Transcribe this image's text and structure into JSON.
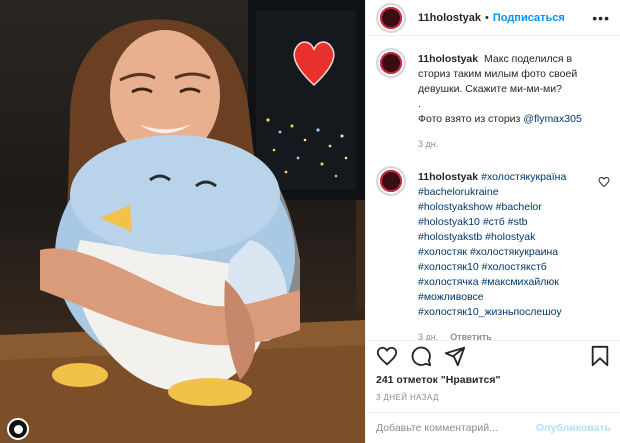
{
  "post": {
    "username": "11holostyak",
    "follow_label": "Подписаться",
    "more_label": "•••"
  },
  "caption": {
    "username": "11holostyak",
    "text": "Макс поделился в сториз таким милым фото своей девушки. Скажите ми-ми-ми?",
    "dot_line": ".",
    "source_prefix": "Фото взято из сториз",
    "source_mention": "@flymax305",
    "time": "3 дн."
  },
  "hashtag_comment": {
    "username": "11holostyak",
    "tags": [
      "#холостякукраїна",
      "#bachelorukraine",
      "#holostyakshow",
      "#bachelor",
      "#holostyak10",
      "#стб",
      "#stb",
      "#holostyakstb",
      "#holostyak",
      "#холостяк",
      "#холостякукраина",
      "#холостяк10",
      "#холостякстб",
      "#холостячка",
      "#максмихайлюк",
      "#можливовсе",
      "#холостяк10_жизньпослешоу"
    ],
    "time": "3 дн.",
    "reply_label": "Ответить"
  },
  "stats": {
    "likes": "241 отметок \"Нравится\"",
    "time_ago": "3 ДНЕЙ НАЗАД"
  },
  "add_comment": {
    "placeholder": "Добавьте комментарий...",
    "post_label": "Опубликовать"
  },
  "icons": {
    "like": "heart-icon",
    "comment": "comment-icon",
    "share": "share-icon",
    "save": "bookmark-icon",
    "sticker": "heart-emoji-icon"
  },
  "colors": {
    "link": "#00376b",
    "follow": "#0095f6",
    "muted": "#8e8e8e",
    "post_disabled": "#b2dffc",
    "sticker_red": "#e8302c"
  }
}
